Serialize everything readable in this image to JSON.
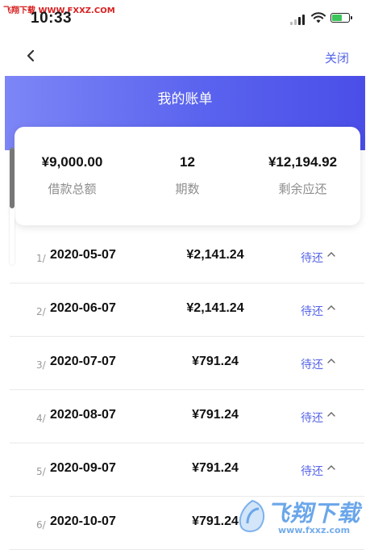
{
  "status_bar": {
    "time": "10:33",
    "watermark_top": "飞翔下载 WWW.FXXZ.COM"
  },
  "nav": {
    "close_label": "关闭"
  },
  "header": {
    "title": "我的账单",
    "accent_start": "#7d86f6",
    "accent_end": "#4a4ee8"
  },
  "summary": [
    {
      "value": "¥9,000.00",
      "label": "借款总额"
    },
    {
      "value": "12",
      "label": "期数"
    },
    {
      "value": "¥12,194.92",
      "label": "剩余应还"
    }
  ],
  "bills": [
    {
      "index": "1/",
      "date": "2020-05-07",
      "amount": "¥2,141.24",
      "status": "待还"
    },
    {
      "index": "2/",
      "date": "2020-06-07",
      "amount": "¥2,141.24",
      "status": "待还"
    },
    {
      "index": "3/",
      "date": "2020-07-07",
      "amount": "¥791.24",
      "status": "待还"
    },
    {
      "index": "4/",
      "date": "2020-08-07",
      "amount": "¥791.24",
      "status": "待还"
    },
    {
      "index": "5/",
      "date": "2020-09-07",
      "amount": "¥791.24",
      "status": "待还"
    },
    {
      "index": "6/",
      "date": "2020-10-07",
      "amount": "¥791.24",
      "status": ""
    }
  ],
  "watermark": {
    "brand": "飞翔下载",
    "url": "www.fxxz.com"
  },
  "icons": {
    "back": "chevron-left-icon",
    "row_toggle": "chevron-up-icon"
  },
  "colors": {
    "accent": "#5564e8"
  }
}
